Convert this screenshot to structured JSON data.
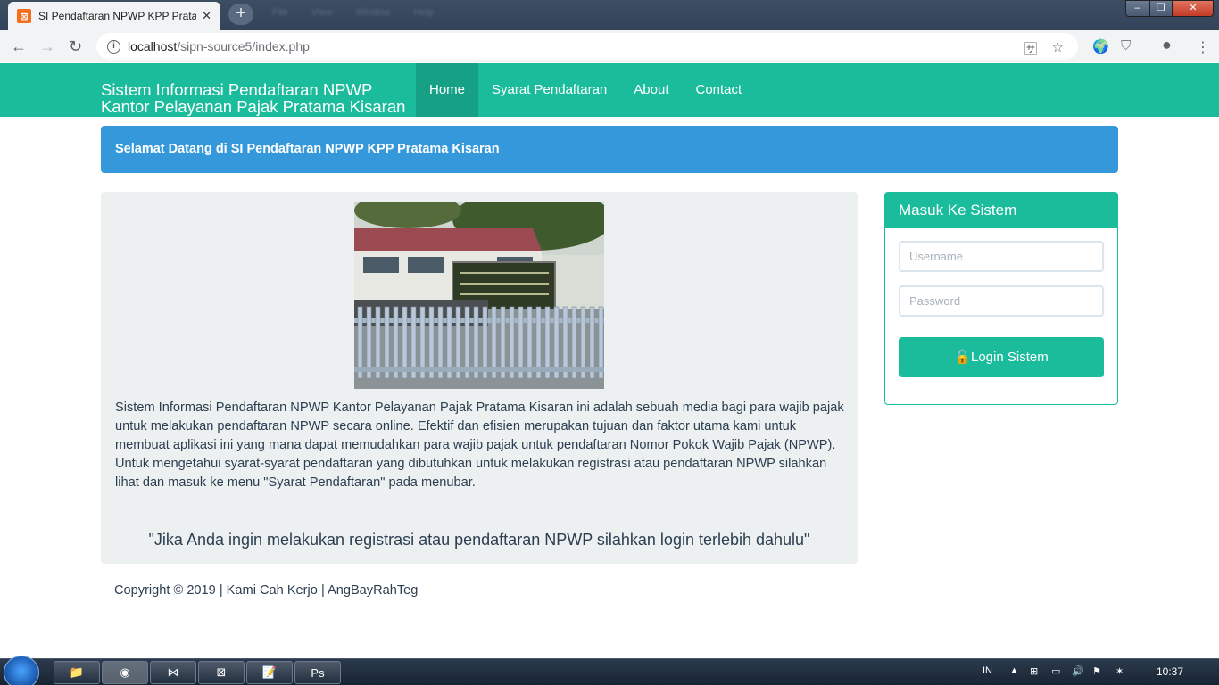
{
  "browser": {
    "tab_title": "SI Pendaftaran NPWP KPP Pratama",
    "tab_icon": "xampp-favicon",
    "close_icon": "close-icon",
    "new_tab_icon": "plus-icon",
    "ghost_menu": [
      "File",
      "View",
      "Window",
      "Help"
    ],
    "url_host": "localhost",
    "url_path": "/sipn-source5/index.php"
  },
  "navbar": {
    "brand_line1": "Sistem Informasi Pendaftaran NPWP",
    "brand_line2": "Kantor Pelayanan Pajak Pratama Kisaran",
    "items": [
      "Home",
      "Syarat Pendaftaran",
      "About",
      "Contact"
    ],
    "active": "Home",
    "color": "#1abc9c"
  },
  "welcome": {
    "text": "Selamat Datang di SI Pendaftaran NPWP KPP Pratama Kisaran",
    "color": "#3498db"
  },
  "main": {
    "image": "kpp-office-building-photo",
    "description": "Sistem Informasi Pendaftaran NPWP Kantor Pelayanan Pajak Pratama Kisaran ini adalah sebuah media bagi para wajib pajak untuk melakukan pendaftaran NPWP secara online. Efektif dan efisien merupakan tujuan dan faktor utama kami untuk membuat aplikasi ini yang mana dapat memudahkan para wajib pajak untuk pendaftaran Nomor Pokok Wajib Pajak (NPWP). Untuk mengetahui syarat-syarat pendaftaran yang dibutuhkan untuk melakukan registrasi atau pendaftaran NPWP silahkan lihat dan masuk ke menu \"Syarat Pendaftaran\" pada menubar.",
    "quote": "\"Jika Anda ingin melakukan registrasi atau pendaftaran NPWP silahkan login terlebih dahulu\""
  },
  "login": {
    "title": "Masuk Ke Sistem",
    "username_placeholder": "Username",
    "password_placeholder": "Password",
    "button_label": "Login Sistem",
    "button_icon": "unlock-icon"
  },
  "footer": {
    "text": "Copyright © 2019 | Kami Cah Kerjo | AngBayRahTeg"
  },
  "taskbar": {
    "language": "IN",
    "time": "10:37"
  }
}
